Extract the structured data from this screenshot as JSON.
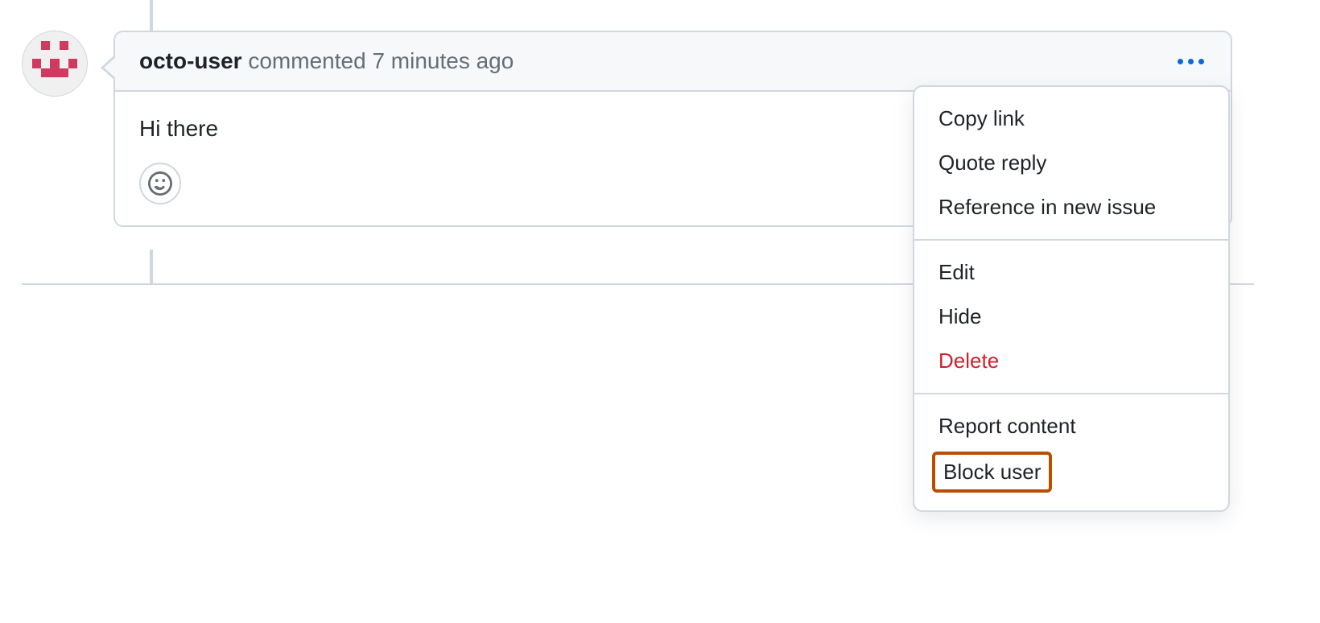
{
  "comment": {
    "author": "octo-user",
    "verb": "commented",
    "timestamp": "7 minutes ago",
    "body": "Hi there"
  },
  "menu": {
    "copy_link": "Copy link",
    "quote_reply": "Quote reply",
    "reference_issue": "Reference in new issue",
    "edit": "Edit",
    "hide": "Hide",
    "delete": "Delete",
    "report_content": "Report content",
    "block_user": "Block user"
  }
}
